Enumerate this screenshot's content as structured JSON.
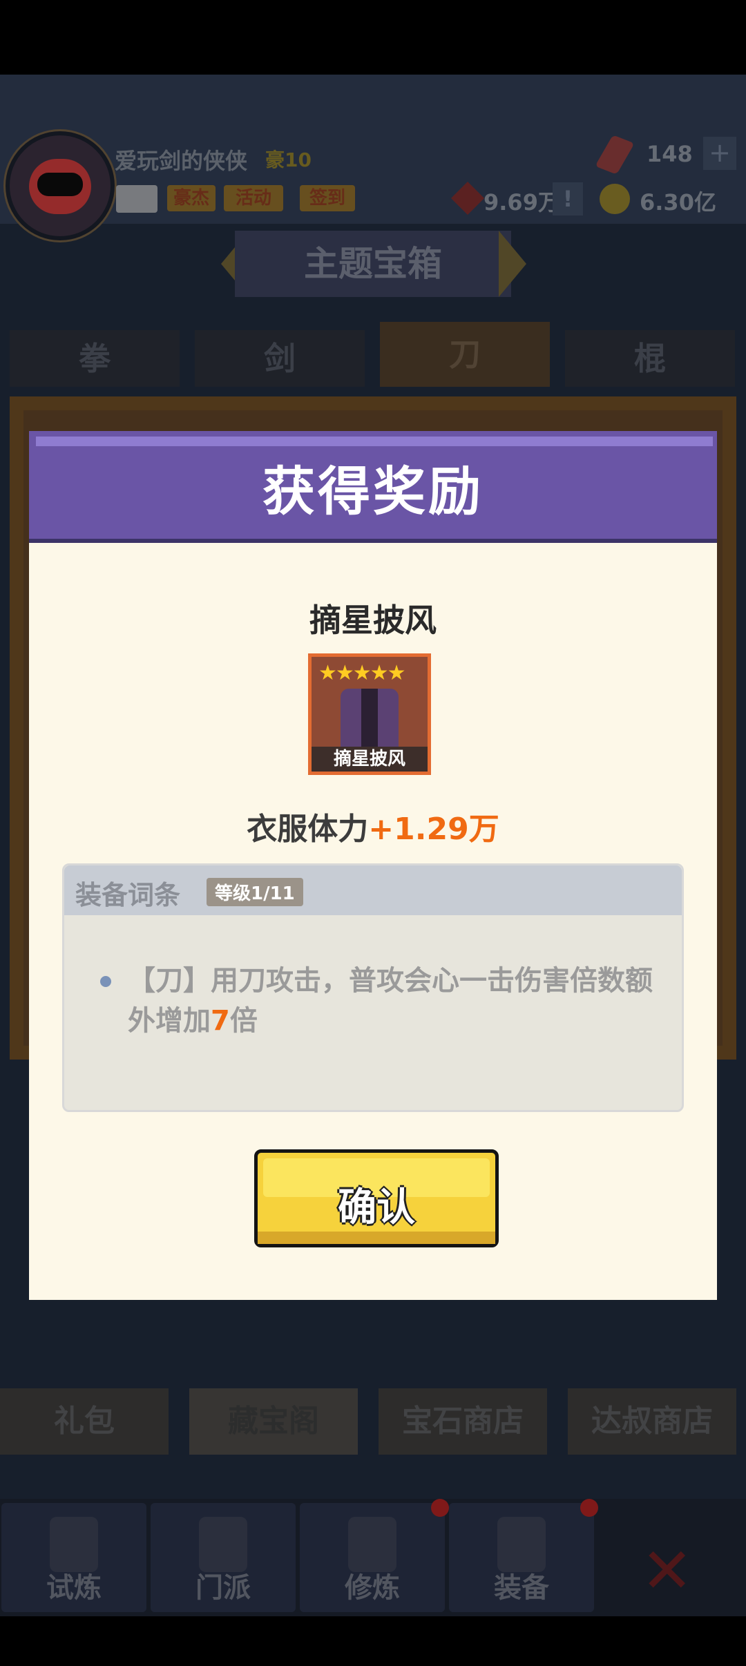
{
  "player": {
    "name": "爱玩剑的侠侠",
    "rank": "豪10"
  },
  "top_buttons": [
    "豪杰",
    "活动",
    "签到"
  ],
  "resources": {
    "gems": "148",
    "power": "9.69万",
    "coins": "6.30亿"
  },
  "banner_title": "主题宝箱",
  "category_tabs": [
    "拳",
    "剑",
    "刀",
    "棍"
  ],
  "shop_tabs": [
    "礼包",
    "藏宝阁",
    "宝石商店",
    "达叔商店"
  ],
  "nav": [
    "试炼",
    "门派",
    "修炼",
    "装备"
  ],
  "modal": {
    "title": "获得奖励",
    "item_name": "摘星披风",
    "item_card_label": "摘星披风",
    "stars": "★★★★★",
    "stat_label": "衣服体力",
    "stat_value": "+1.29万",
    "attr_title": "装备词条",
    "attr_level": "等级1/11",
    "attr_text_before": "【刀】用刀攻击，普攻会心一击伤害倍数额外增加",
    "attr_text_highlight": "7",
    "attr_text_after": "倍",
    "confirm": "确认"
  },
  "colors": {
    "modal_header": "#6a55a6",
    "accent_orange": "#f06a12",
    "confirm_yellow": "#f6d23c"
  }
}
